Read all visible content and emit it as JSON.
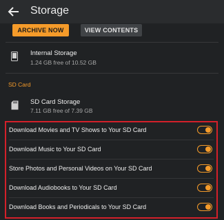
{
  "header": {
    "title": "Storage"
  },
  "buttons": {
    "archive_label": "ARCHIVE NOW",
    "view_label": "VIEW CONTENTS"
  },
  "internal": {
    "title": "Internal Storage",
    "subtitle": "1.24 GB free of 10.52 GB"
  },
  "sd_section": {
    "heading": "SD Card"
  },
  "sd": {
    "title": "SD Card Storage",
    "subtitle": "7.11 GB free of 7.39 GB"
  },
  "toggles": [
    {
      "label": "Download Movies and TV Shows to Your SD Card",
      "state": "on"
    },
    {
      "label": "Download Music to Your SD Card",
      "state": "on"
    },
    {
      "label": "Store Photos and Personal Videos on Your SD Card",
      "state": "on"
    },
    {
      "label": "Download Audiobooks to Your SD Card",
      "state": "on"
    },
    {
      "label": "Download Books and Periodicals to Your SD Card",
      "state": "on"
    }
  ],
  "colors": {
    "accent": "#f59b2a",
    "highlight": "#d4202a",
    "background": "#202224"
  }
}
